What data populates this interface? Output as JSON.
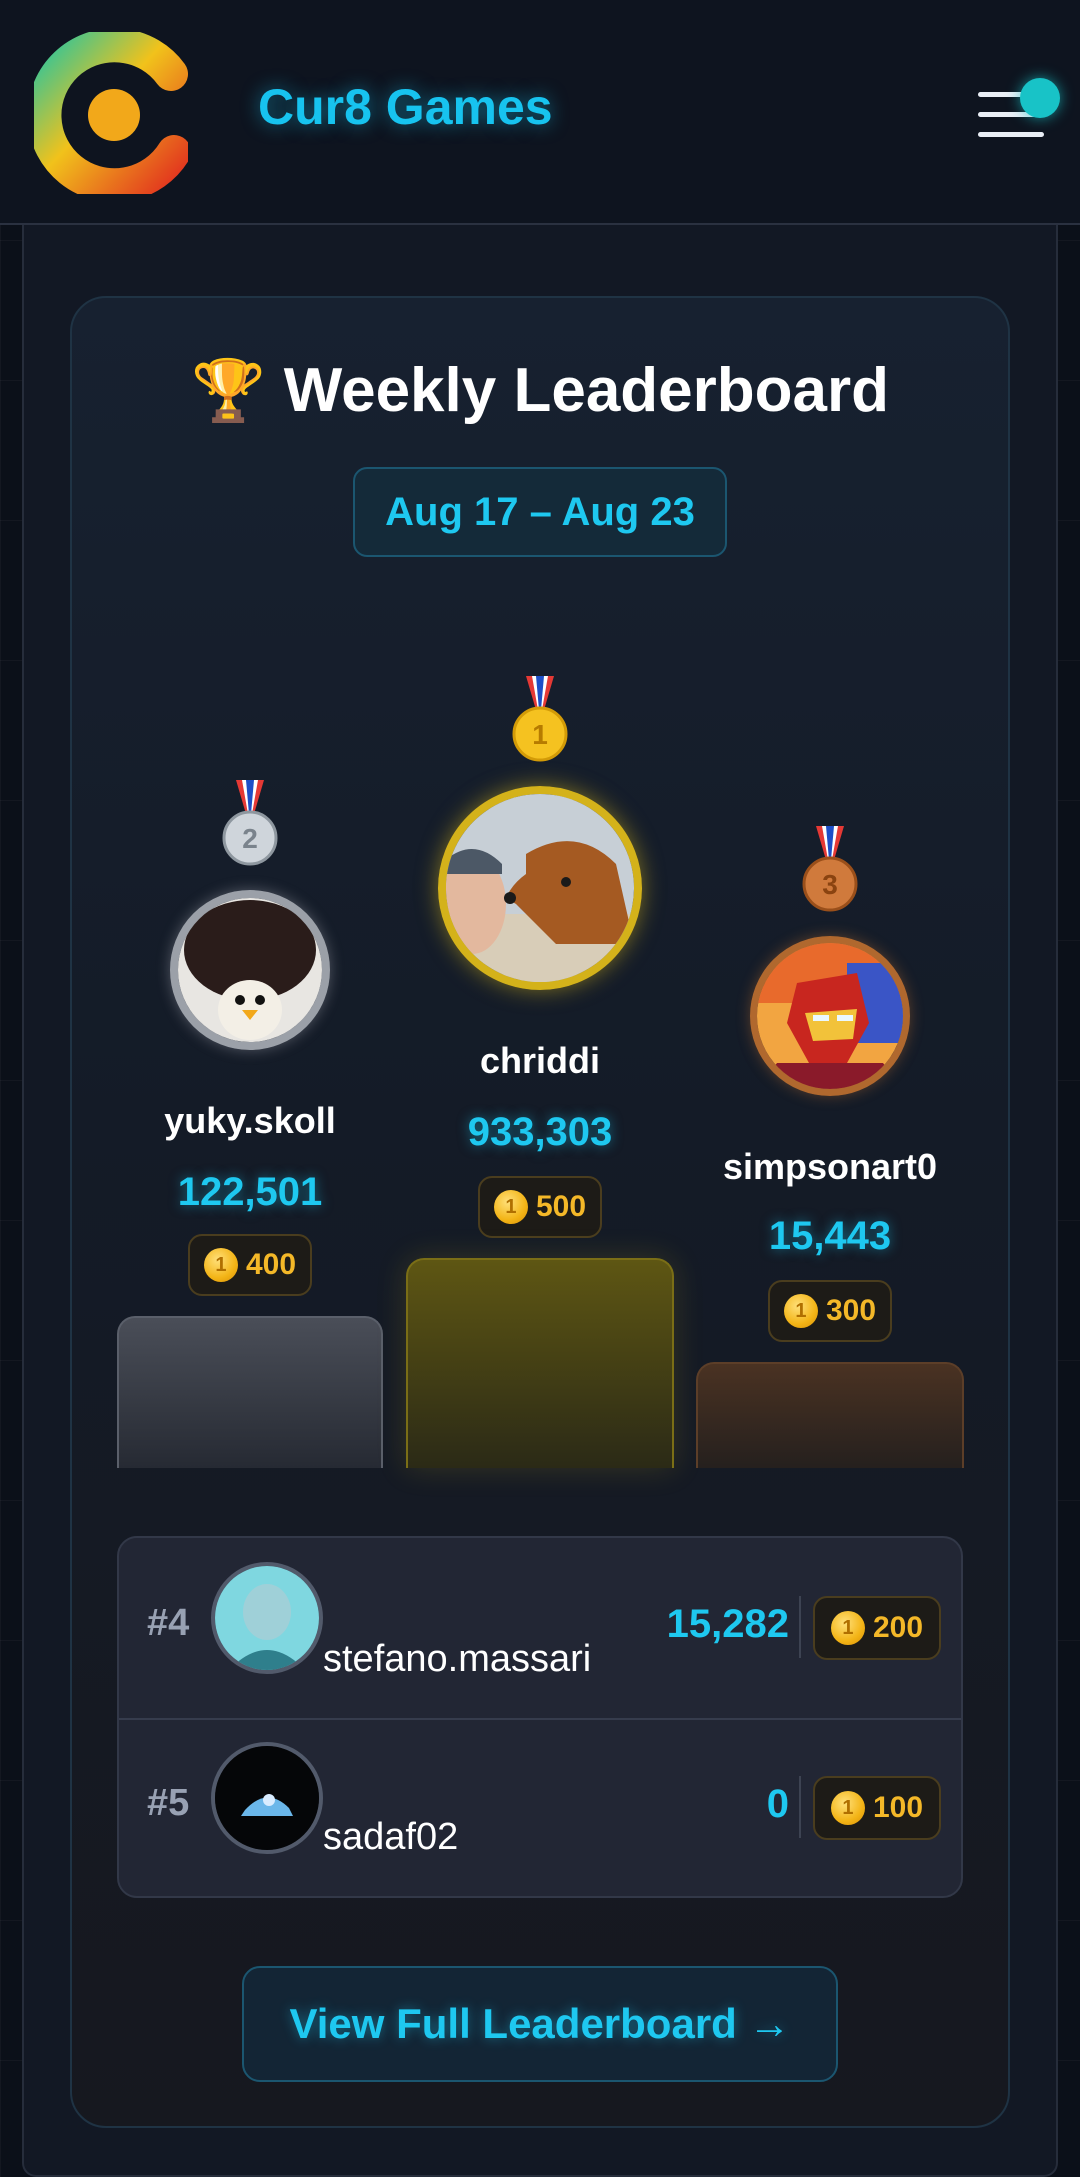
{
  "header": {
    "brand": "Cur8 Games",
    "logo_icon": "cur8-logo-icon",
    "menu_icon": "hamburger-menu-icon",
    "notification_color": "#18c3c7"
  },
  "leaderboard": {
    "trophy": "🏆",
    "title": "Weekly Leaderboard",
    "date_range": "Aug 17 – Aug 23",
    "podium": [
      {
        "place": 2,
        "medal": "2",
        "name": "yuky.skoll",
        "score": "122,501",
        "reward": "400",
        "color": "#9aa3ad"
      },
      {
        "place": 1,
        "medal": "1",
        "name": "chriddi",
        "score": "933,303",
        "reward": "500",
        "color": "#d4b21a"
      },
      {
        "place": 3,
        "medal": "3",
        "name": "simpsonart0",
        "score": "15,443",
        "reward": "300",
        "color": "#b0682e"
      }
    ],
    "rows": [
      {
        "rank": "#4",
        "name": "stefano.massari",
        "score": "15,282",
        "reward": "200"
      },
      {
        "rank": "#5",
        "name": "sadaf02",
        "score": "0",
        "reward": "100"
      }
    ],
    "view_all": "View Full Leaderboard →"
  }
}
